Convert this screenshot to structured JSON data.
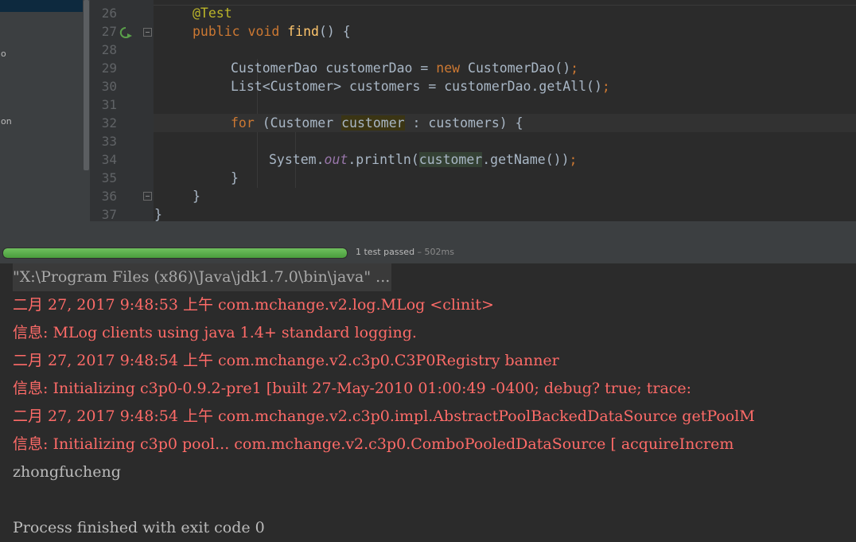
{
  "project_panel": {
    "fragments": [
      "o",
      "on"
    ]
  },
  "editor": {
    "line_numbers": [
      "26",
      "27",
      "28",
      "29",
      "30",
      "31",
      "32",
      "33",
      "34",
      "35",
      "36",
      "37"
    ],
    "lines": {
      "l26_ann": "@Test",
      "l27_kw1": "public",
      "l27_kw2": "void",
      "l27_fn": "find",
      "l27_rest": "() {",
      "l29_type": "CustomerDao customerDao = ",
      "l29_new": "new",
      "l29_rest": " CustomerDao()",
      "l29_semi": ";",
      "l30_code": "List<Customer> customers = customerDao.getAll()",
      "l30_semi": ";",
      "l32_for": "for",
      "l32_a": " (Customer ",
      "l32_var": "customer",
      "l32_b": " : customers) {",
      "l34_a": "System.",
      "l34_out": "out",
      "l34_b": ".println(",
      "l34_var": "customer",
      "l34_c": ".getName())",
      "l34_semi": ";",
      "l35_brace": "}",
      "l36_brace": "}",
      "l37_brace": "}"
    }
  },
  "test_bar": {
    "progress": 1.0,
    "status": "1 test passed",
    "time": " – 502ms"
  },
  "console": {
    "lines": [
      "\"X:\\Program Files (x86)\\Java\\jdk1.7.0\\bin\\java\" ...",
      "二月 27, 2017 9:48:53 上午 com.mchange.v2.log.MLog <clinit>",
      "信息: MLog clients using java 1.4+ standard logging.",
      "二月 27, 2017 9:48:54 上午 com.mchange.v2.c3p0.C3P0Registry banner",
      "信息: Initializing c3p0-0.9.2-pre1 [built 27-May-2010 01:00:49 -0400; debug? true; trace:",
      "二月 27, 2017 9:48:54 上午 com.mchange.v2.c3p0.impl.AbstractPoolBackedDataSource getPoolM",
      "信息: Initializing c3p0 pool... com.mchange.v2.c3p0.ComboPooledDataSource [ acquireIncrem",
      "zhongfucheng",
      "",
      "Process finished with exit code 0"
    ]
  },
  "colors": {
    "editor_bg": "#2b2b2b",
    "keyword": "#cc7832",
    "function": "#ffc66d",
    "annotation": "#bbb529",
    "error_text": "#ff6b68",
    "progress_green": "#4a9e3d"
  }
}
